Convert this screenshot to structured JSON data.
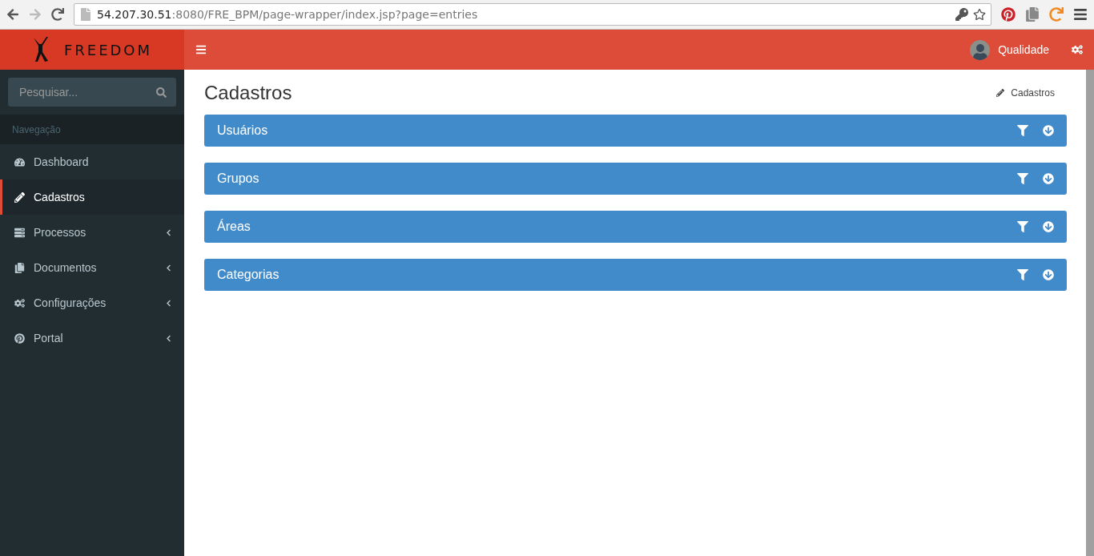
{
  "browser": {
    "url_host": "54.207.30.51",
    "url_path": ":8080/FRE_BPM/page-wrapper/index.jsp?page=entries"
  },
  "header": {
    "logo_text": "FREEDOM",
    "user_name": "Qualidade"
  },
  "sidebar": {
    "search": {
      "placeholder": "Pesquisar..."
    },
    "section_label": "Navegação",
    "items": [
      {
        "label": "Dashboard",
        "selected": false,
        "has_submenu": false
      },
      {
        "label": "Cadastros",
        "selected": true,
        "has_submenu": false
      },
      {
        "label": "Processos",
        "selected": false,
        "has_submenu": true
      },
      {
        "label": "Documentos",
        "selected": false,
        "has_submenu": true
      },
      {
        "label": "Configurações",
        "selected": false,
        "has_submenu": true
      },
      {
        "label": "Portal",
        "selected": false,
        "has_submenu": true
      }
    ]
  },
  "content": {
    "title": "Cadastros",
    "breadcrumb": "Cadastros",
    "panels": [
      {
        "title": "Usuários"
      },
      {
        "title": "Grupos"
      },
      {
        "title": "Áreas"
      },
      {
        "title": "Categorias"
      }
    ]
  }
}
